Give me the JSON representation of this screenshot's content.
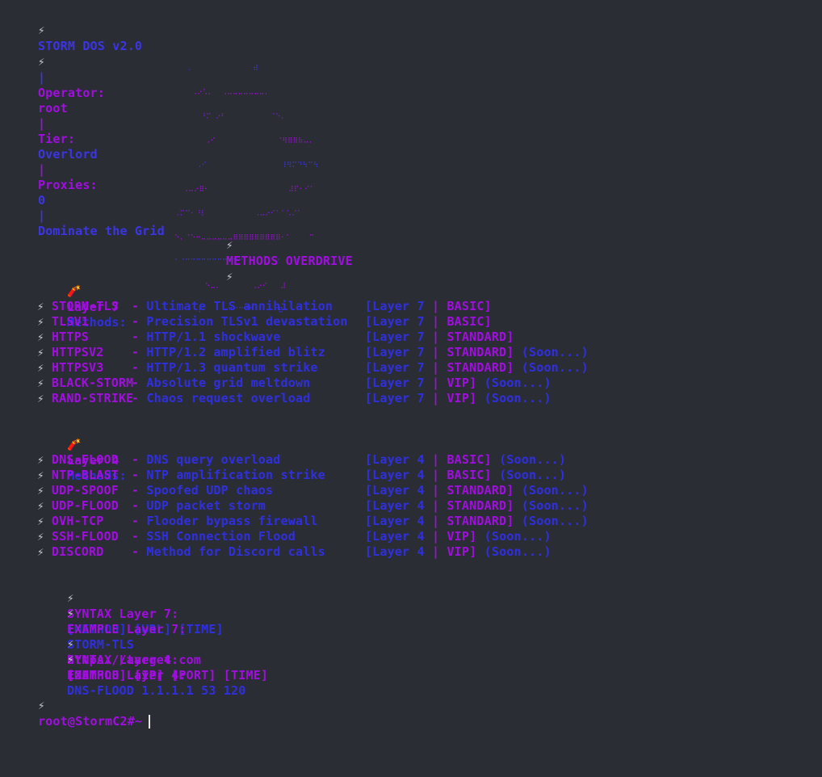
{
  "header": {
    "bolt": "⚡",
    "app": "STORM DOS v2.0",
    "sep": "|",
    "operator_label": "Operator:",
    "operator_value": "root",
    "tier_label": "Tier:",
    "tier_value": "Overlord",
    "proxies_label": "Proxies:",
    "proxies_value": "0",
    "tagline": "Dominate the Grid"
  },
  "banner": {
    "art_lines": [
      "     .              ⠾",
      "      ⠠⠔⠡⠄  ⠠⠤⠤⠤⠤⠤⠤⠤⠄",
      "        ⠘⠍ ⠔⠃          ⠈⠑⠄",
      "         ⠠⠊              ⠈⠻⠿⠿⠷⠤⠄",
      "       ⠠⠊                 ⠸⠻⠍⠙⠳⠉⠳",
      "    ⠠⠤⠔⠿⠂                  ⠼⠏⠂⠊⠁",
      "  ⠠⠍⠉⠂⠘⠇           ⠠⠤⠔⠊⠁⠁⠡⠌⠁",
      "  ⠑⠄⠈⠑⠒⠤⠤⠤⠤⠤⠤⠿⠿⠿⠿⠿⠿⠿⠿⠿⠂⠁    ⠉",
      "  ⠁⠈⠉⠉⠉⠉⠉⠉⠉⠉⠉⠉⠉⠁      ⠊   ⠸",
      "         ⠑⠤⠄       ⠠⠔⠊   ⠼",
      "       ⠸      ⠉⠉⠉⠉⠉⠁   ⠈⠿⠁"
    ],
    "title": "METHODS OVERDRIVE"
  },
  "layer7": {
    "icon": "🧨",
    "heading_label": "Layer 7",
    "heading_suffix": "Methods:",
    "methods": [
      {
        "name": "STORM-TLS",
        "desc": "Ultimate TLS annihilation",
        "layer": "Layer 7",
        "tier": "BASIC]",
        "soon": ""
      },
      {
        "name": "TLSV1",
        "desc": "Precision TLSv1 devastation",
        "layer": "Layer 7",
        "tier": "BASIC]",
        "soon": ""
      },
      {
        "name": "HTTPS",
        "desc": "HTTP/1.1 shockwave",
        "layer": "Layer 7",
        "tier": "STANDARD]",
        "soon": ""
      },
      {
        "name": "HTTPSV2",
        "desc": "HTTP/1.2 amplified blitz",
        "layer": "Layer 7",
        "tier": "STANDARD]",
        "soon": "(Soon...)"
      },
      {
        "name": "HTTPSV3",
        "desc": "HTTP/1.3 quantum strike",
        "layer": "Layer 7",
        "tier": "STANDARD]",
        "soon": "(Soon...)"
      },
      {
        "name": "BLACK-STORM",
        "desc": "Absolute grid meltdown",
        "layer": "Layer 7",
        "tier": "VIP]",
        "soon": "(Soon...)"
      },
      {
        "name": "RAND-STRIKE",
        "desc": "Chaos request overload",
        "layer": "Layer 7",
        "tier": "VIP]",
        "soon": "(Soon...)"
      }
    ]
  },
  "layer4": {
    "icon": "🧨",
    "heading_label": "Layer 4",
    "heading_suffix": "Methods:",
    "methods": [
      {
        "name": "DNS-FLOOD",
        "desc": "DNS query overload",
        "layer": "Layer 4",
        "tier": "BASIC]",
        "soon": "(Soon...)"
      },
      {
        "name": "NTP-BLAST",
        "desc": "NTP amplification strike",
        "layer": "Layer 4",
        "tier": "BASIC]",
        "soon": "(Soon...)"
      },
      {
        "name": "UDP-SPOOF",
        "desc": "Spoofed UDP chaos",
        "layer": "Layer 4",
        "tier": "STANDARD]",
        "soon": "(Soon...)"
      },
      {
        "name": "UDP-FLOOD",
        "desc": "UDP packet storm",
        "layer": "Layer 4",
        "tier": "STANDARD]",
        "soon": "(Soon...)"
      },
      {
        "name": "OVH-TCP",
        "desc": "Flooder bypass firewall",
        "layer": "Layer 4",
        "tier": "STANDARD]",
        "soon": "(Soon...)"
      },
      {
        "name": "SSH-FLOOD",
        "desc": "SSH Connection Flood",
        "layer": "Layer 4",
        "tier": "VIP]",
        "soon": "(Soon...)"
      },
      {
        "name": "DISCORD",
        "desc": "Method for Discord calls",
        "layer": "Layer 4",
        "tier": "VIP]",
        "soon": "(Soon...)"
      }
    ]
  },
  "syntax": {
    "l7_syntax_label": "SYNTAX Layer 7:",
    "l7_syntax_value": "[METHOD] [URL] [TIME]",
    "l7_example_label": "EXAMPLE Layer 7:",
    "l7_example_method": "STORM-TLS",
    "l7_example_url": "https://target.com",
    "l7_example_time": "120",
    "l4_syntax_label": "SYNTAX Layer 4:",
    "l4_syntax_value": "[METHOD] [IP] [PORT] [TIME]",
    "l4_example_label": "EXAMPLE Layer 4:",
    "l4_example_value": "DNS-FLOOD 1.1.1.1 53 120"
  },
  "prompt": {
    "text": "root@StormC2#~"
  }
}
